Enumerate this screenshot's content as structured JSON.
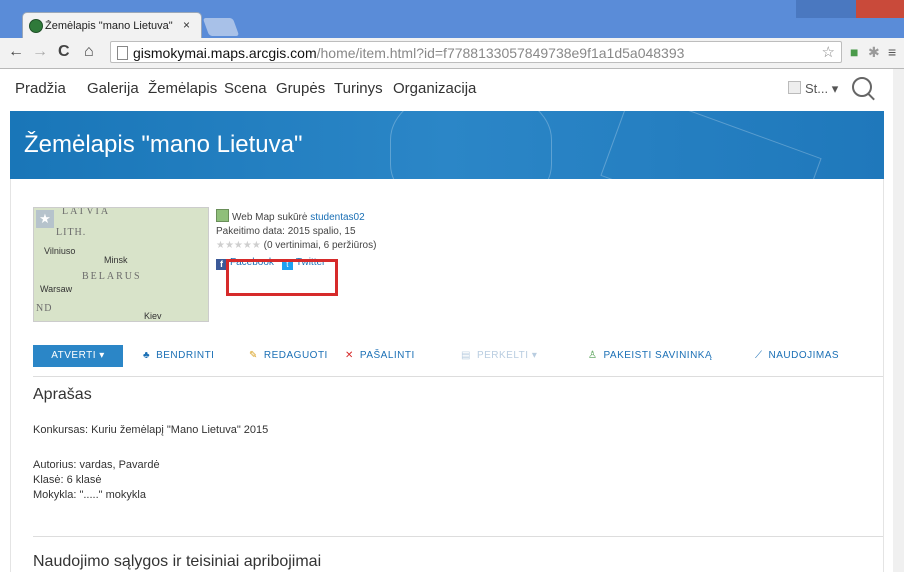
{
  "browser": {
    "tab_title": "Žemėlapis \"mano Lietuva\"",
    "tab_close": "×",
    "url_host": "gismokymai.maps.arcgis.com",
    "url_path": "/home/item.html?id=f7788133057849738e9f1a1d5a048393",
    "back": "←",
    "forward": "→",
    "reload": "C",
    "home": "⌂",
    "bookmark_star": "☆",
    "menu": "≡"
  },
  "topnav": {
    "items": [
      "Pradžia",
      "Galerija",
      "Žemėlapis",
      "Scena",
      "Grupės",
      "Turinys",
      "Organizacija"
    ],
    "signin": "St...",
    "signin_caret": "▾"
  },
  "banner": {
    "title": "Žemėlapis \"mano Lietuva\""
  },
  "thumbnail": {
    "labels": [
      "LATVIA",
      "LITH.",
      "Vilniuso",
      "Minsk",
      "BELARUS",
      "Warsaw",
      "ND",
      "Kiev"
    ]
  },
  "meta": {
    "type_text": "Web Map sukūrė",
    "owner": "studentas02",
    "modified": "Pakeitimo data: 2015 spalio, 15",
    "rating_stars": "★★★★★",
    "rating_text": "(0 vertinimai, 6 peržiūros)",
    "facebook": "Facebook",
    "twitter": "Twitter"
  },
  "actions": {
    "open": "ATVERTI ▾",
    "share": "BENDRINTI",
    "edit": "REDAGUOTI",
    "delete": "PAŠALINTI",
    "move": "PERKELTI ▾",
    "change_owner": "PAKEISTI SAVININKĄ",
    "usage": "NAUDOJIMAS"
  },
  "description": {
    "title": "Aprašas",
    "line1": "Konkursas: Kuriu žemėlapį \"Mano Lietuva\" 2015",
    "line2": "Autorius: vardas, Pavardė",
    "line3": "Klasė: 6 klasė",
    "line4": "Mokykla: \".....\" mokykla"
  },
  "terms": {
    "title": "Naudojimo sąlygos ir teisiniai apribojimai"
  },
  "colors": {
    "accent": "#2b86c7",
    "highlight": "#d62a2a",
    "link": "#1a6fb5"
  }
}
